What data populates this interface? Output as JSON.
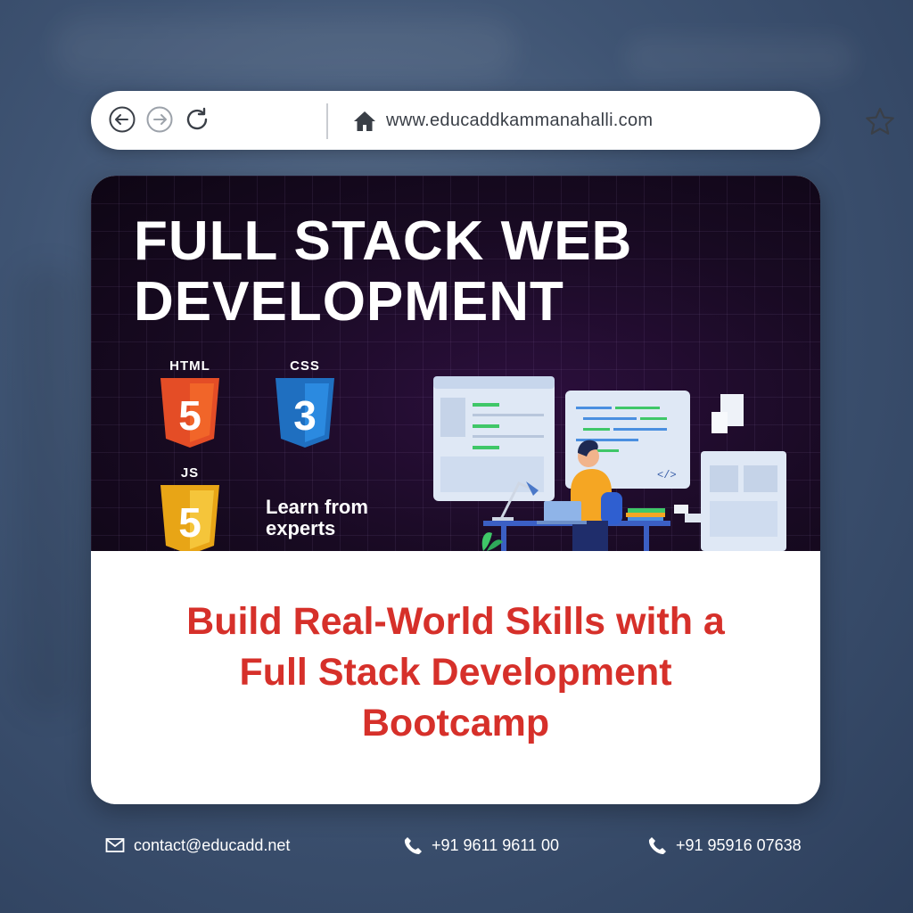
{
  "browser": {
    "url": "www.educaddkammanahalli.com",
    "icons": [
      "back-arrow-icon",
      "forward-arrow-icon",
      "refresh-icon",
      "home-icon",
      "star-icon"
    ]
  },
  "banner": {
    "headline_line1": "FULL STACK WEB",
    "headline_line2": "DEVELOPMENT",
    "badges": [
      {
        "label": "HTML",
        "digit": "5",
        "color": "#e44d26"
      },
      {
        "label": "CSS",
        "digit": "3",
        "color": "#1f6fc0"
      },
      {
        "label": "JS",
        "digit": "5",
        "color": "#f0b21c"
      }
    ],
    "learn_line1": "Learn from",
    "learn_line2": "experts"
  },
  "tagline": {
    "line1": "Build Real-World Skills with a",
    "line2": "Full Stack Development",
    "line3": "Bootcamp"
  },
  "contacts": {
    "email": "contact@educadd.net",
    "phone1": "+91 9611 9611 00",
    "phone2": "+91 95916 07638"
  },
  "colors": {
    "accent_red": "#d6302a",
    "background": "#3f5473"
  }
}
